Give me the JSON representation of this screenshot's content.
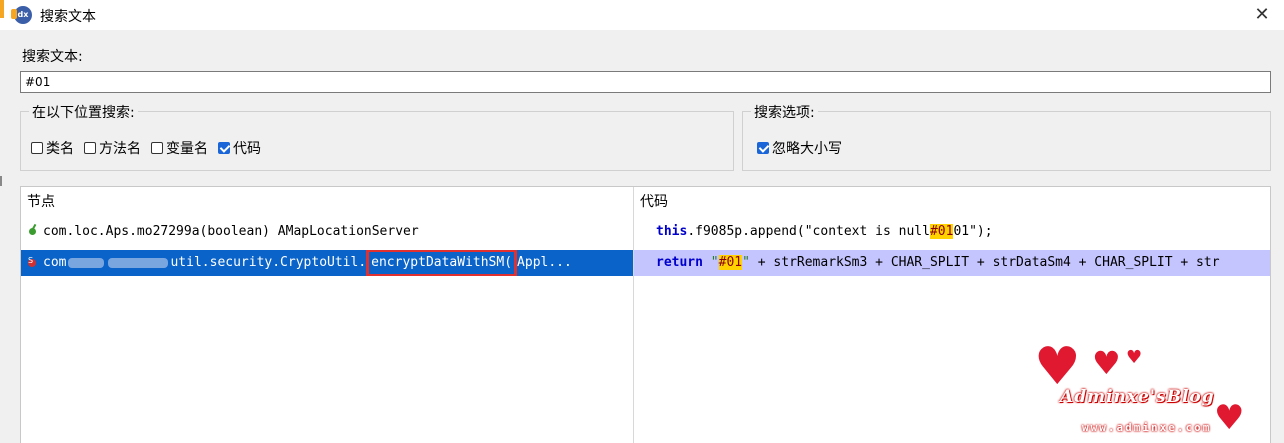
{
  "window": {
    "title": "搜索文本",
    "app_icon_text": "dx",
    "close_glyph": "✕"
  },
  "search": {
    "label": "搜索文本:",
    "value": "#01"
  },
  "search_location": {
    "title": "在以下位置搜索:",
    "options": [
      {
        "label": "类名",
        "checked": false
      },
      {
        "label": "方法名",
        "checked": false
      },
      {
        "label": "变量名",
        "checked": false
      },
      {
        "label": "代码",
        "checked": true
      }
    ]
  },
  "search_options": {
    "title": "搜索选项:",
    "options": [
      {
        "label": "忽略大小写",
        "checked": true
      }
    ]
  },
  "results": {
    "columns": [
      "节点",
      "代码"
    ],
    "rows": [
      {
        "node_icon": "method-green-icon",
        "node": "com.loc.Aps.mo27299a(boolean) AMapLocationServer",
        "code_kw": "this",
        "code_pre": ".f9085p.append(\"context is null",
        "code_hl": "#01",
        "code_post": "01\");",
        "selected": false
      },
      {
        "node_icon": "method-static-red-icon",
        "node_pre": "com",
        "node_mid": "util.security.CryptoUtil.",
        "node_boxed": "encryptDataWithSM(",
        "node_post": "Appl...",
        "code_kw": "return",
        "code_q1": " \"",
        "code_hl": "#01",
        "code_q2": "\"",
        "code_post": " + strRemarkSm3 + CHAR_SPLIT + strDataSm4 + CHAR_SPLIT + str",
        "selected": true
      }
    ]
  },
  "watermark": {
    "text": "Adminxe'sBlog",
    "url": "www.adminxe.com"
  },
  "colors": {
    "selection": "#0a63c9",
    "code_selection": "#c4c4ff",
    "highlight": "#ffd200",
    "annotation_box": "#e03030"
  }
}
